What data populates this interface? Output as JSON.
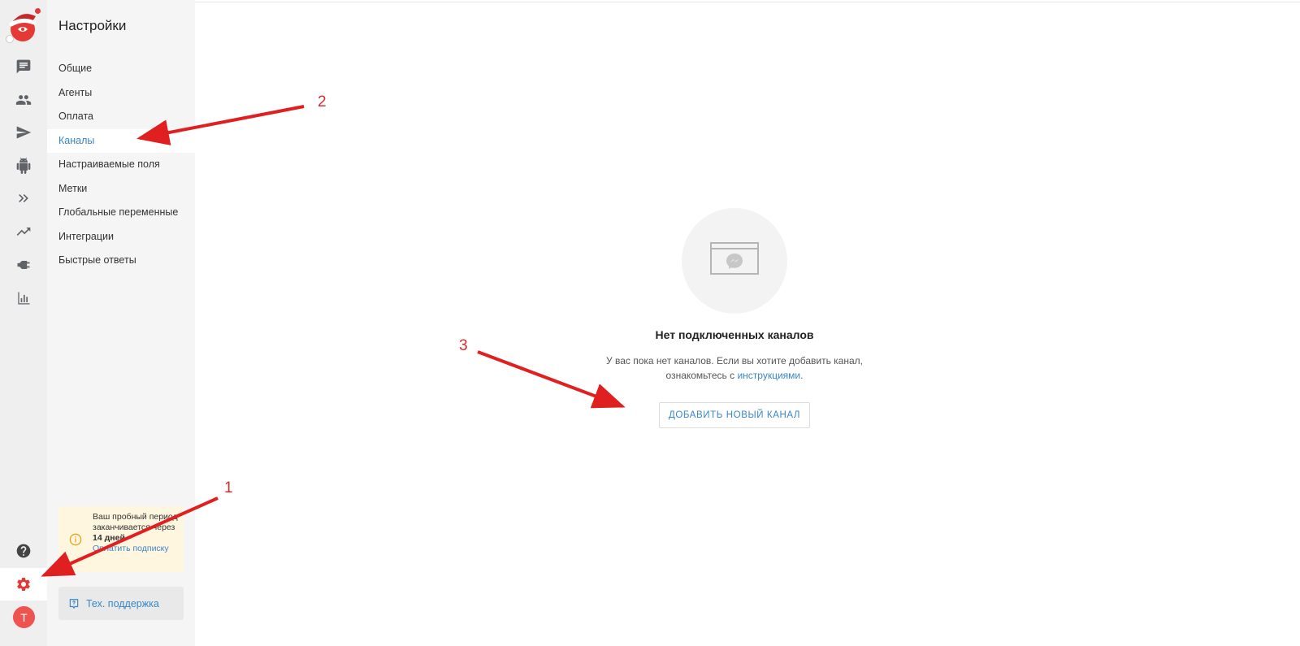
{
  "panel": {
    "title": "Настройки",
    "menu": [
      {
        "label": "Общие"
      },
      {
        "label": "Агенты"
      },
      {
        "label": "Оплата"
      },
      {
        "label": "Каналы"
      },
      {
        "label": "Настраиваемые поля"
      },
      {
        "label": "Метки"
      },
      {
        "label": "Глобальные переменные"
      },
      {
        "label": "Интеграции"
      },
      {
        "label": "Быстрые ответы"
      }
    ],
    "active_item": "Каналы"
  },
  "trial": {
    "line1": "Ваш пробный период заканчивается через ",
    "days": "14 дней",
    "period": ".",
    "link": "Оплатить подписку"
  },
  "support": {
    "label": "Тех. поддержка"
  },
  "avatar": {
    "initial": "T"
  },
  "empty_state": {
    "title": "Нет подключенных каналов",
    "desc_prefix": "У вас пока нет каналов. Если вы хотите добавить канал, ознакомьтесь с ",
    "desc_link": "инструкциями",
    "desc_suffix": ".",
    "button": "ДОБАВИТЬ НОВЫЙ КАНАЛ"
  },
  "annotations": {
    "n1": "1",
    "n2": "2",
    "n3": "3"
  },
  "icons": {
    "rail": [
      "logo-icon",
      "chat-icon",
      "people-icon",
      "send-icon",
      "bot-icon",
      "forward-icon",
      "trending-icon",
      "plug-icon",
      "bar-chart-icon",
      "help-icon",
      "gear-icon"
    ],
    "colors": {
      "accent": "#3a86c8",
      "active_icon": "#e53935",
      "annotation": "#d32f2f",
      "trial_bg": "#fff6e0"
    }
  }
}
